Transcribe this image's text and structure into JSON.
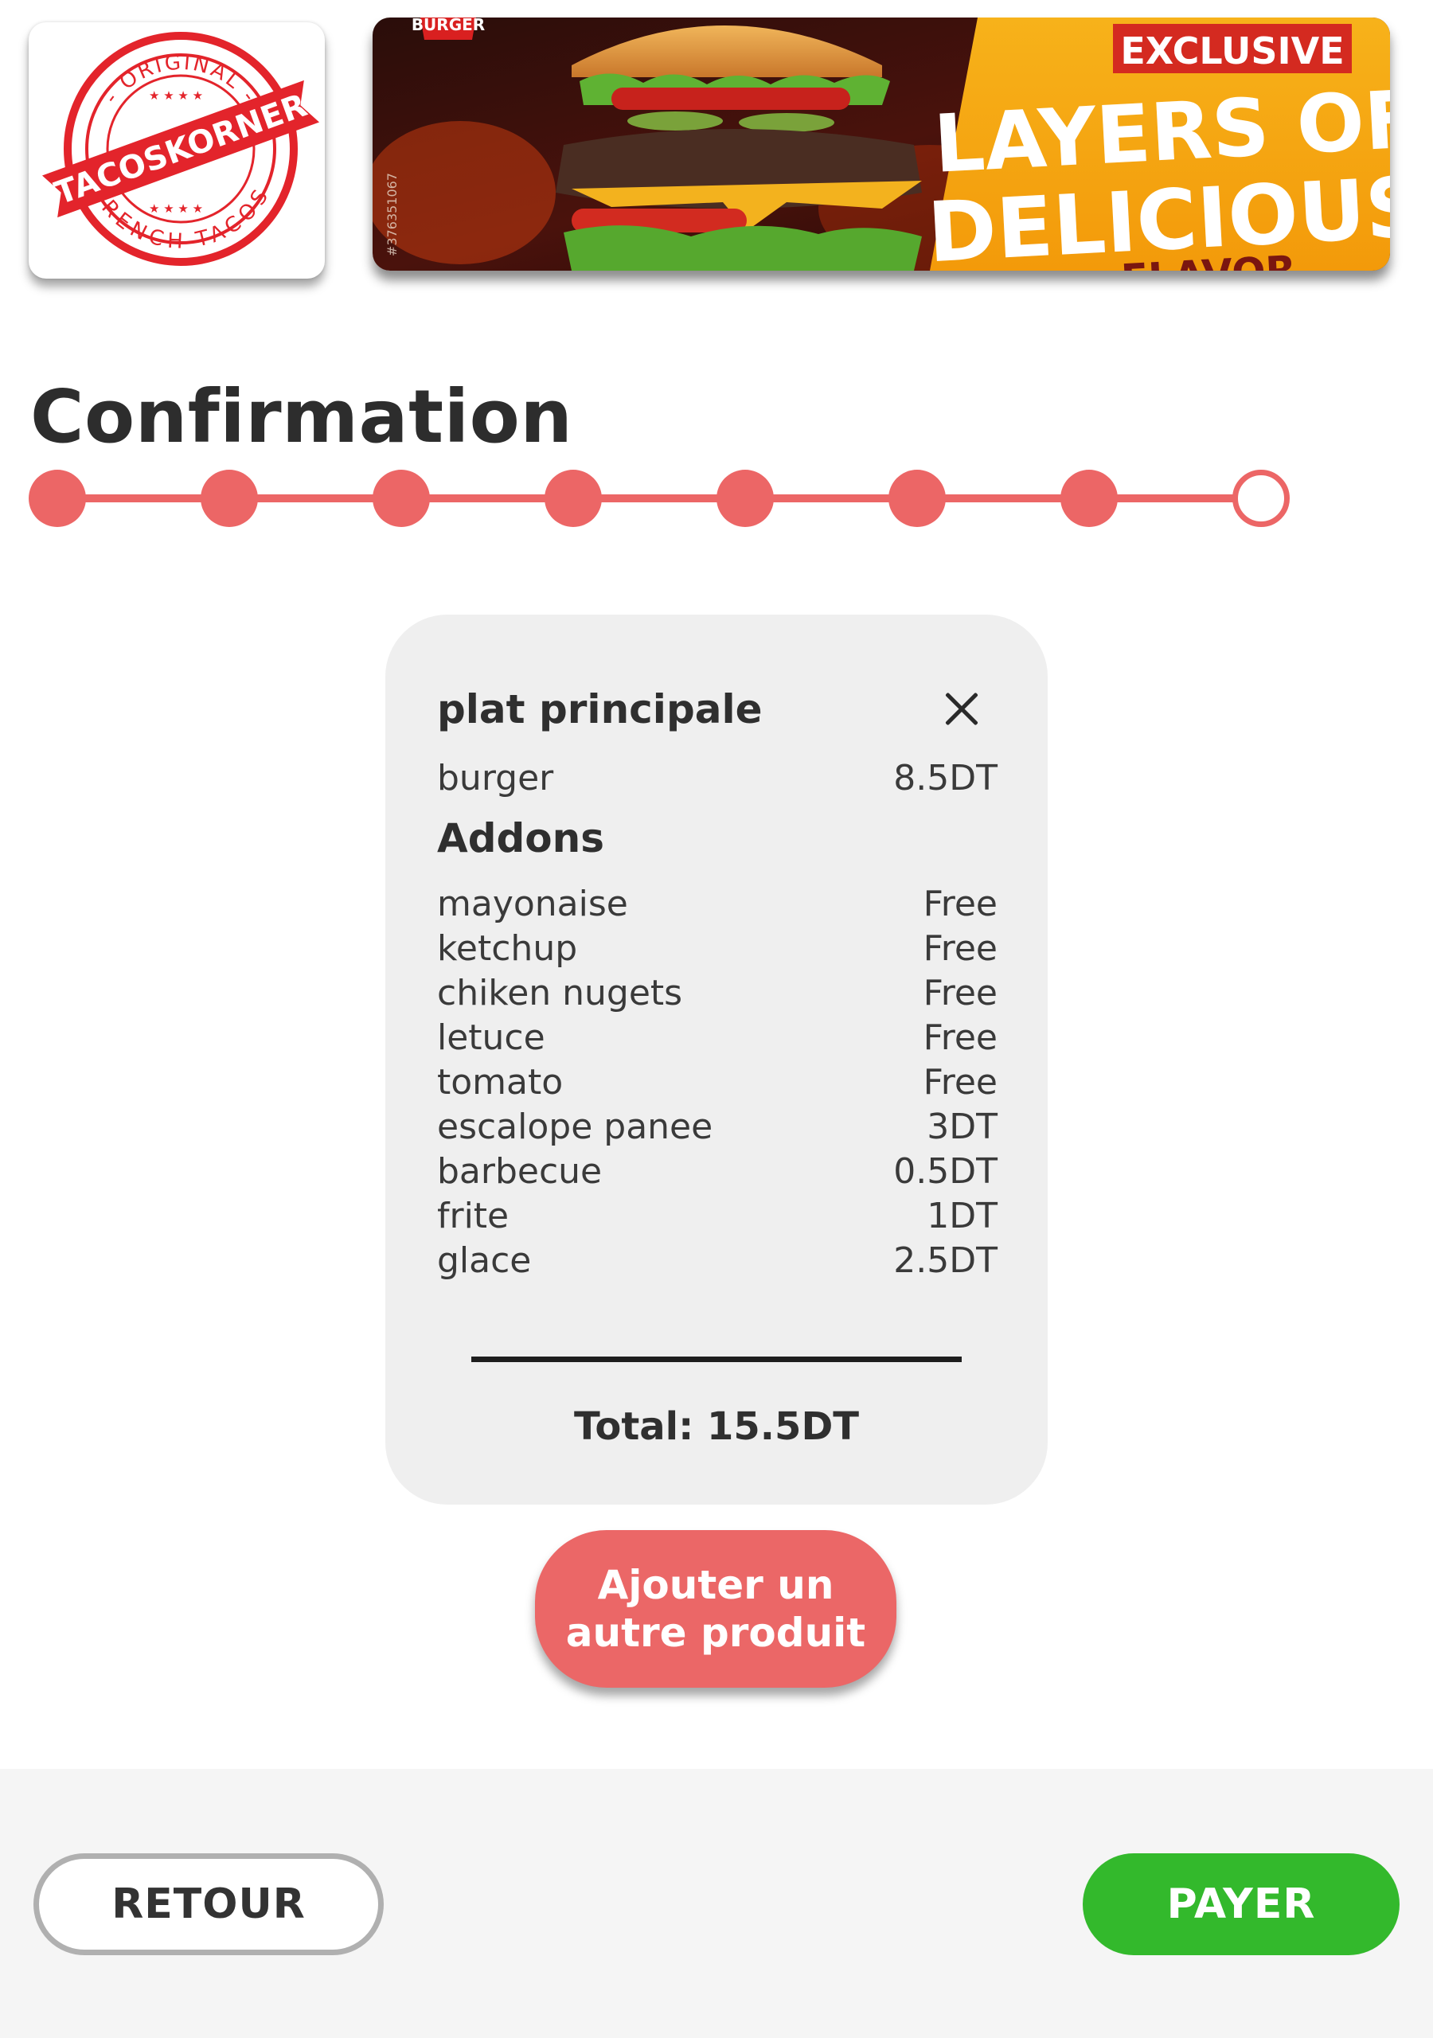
{
  "header": {
    "logo": {
      "alt": "Tacos Korner logo",
      "stamp_text_top": "- ORIGINAL -",
      "stamp_text_center": "TACOSKORNER",
      "stamp_text_bottom": "- FRENCH TACOS -",
      "color": "#e3242b"
    },
    "banner": {
      "alt": "Burger promotional banner",
      "tag": "BURGER",
      "headline_1": "EXCLUSIVE",
      "headline_2": "LAYERS OF",
      "headline_3": "DELICIOUS",
      "headline_4": "FLAVOR",
      "watermark": "#376351067"
    }
  },
  "page": {
    "title": "Confirmation"
  },
  "stepper": {
    "total_steps": 8,
    "current_step": 8,
    "accent_color": "#ec6666"
  },
  "receipt": {
    "section_title": "plat principale",
    "close_icon": "close-icon",
    "main_item": {
      "name": "burger",
      "price": "8.5DT"
    },
    "addons_title": "Addons",
    "addons": [
      {
        "name": "mayonaise",
        "price": "Free"
      },
      {
        "name": "ketchup",
        "price": "Free"
      },
      {
        "name": "chiken nugets",
        "price": "Free"
      },
      {
        "name": "letuce",
        "price": "Free"
      },
      {
        "name": "tomato",
        "price": "Free"
      },
      {
        "name": "escalope panee",
        "price": "3DT"
      },
      {
        "name": "barbecue",
        "price": "0.5DT"
      },
      {
        "name": "frite",
        "price": "1DT"
      },
      {
        "name": "glace",
        "price": "2.5DT"
      }
    ],
    "total": "Total: 15.5DT"
  },
  "actions": {
    "add_product_line1": "Ajouter un",
    "add_product_line2": "autre produit",
    "back_label": "RETOUR",
    "pay_label": "PAYER",
    "add_color": "#eb6767",
    "pay_color": "#33b92c"
  }
}
